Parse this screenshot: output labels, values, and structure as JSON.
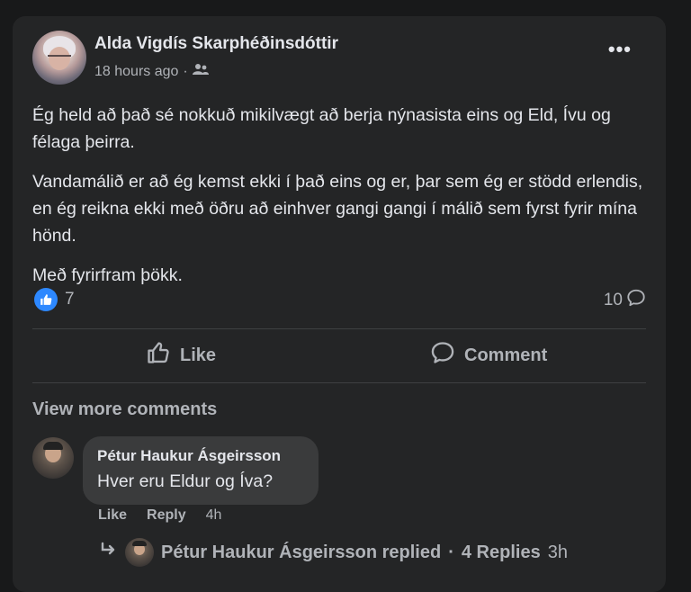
{
  "post": {
    "author": "Alda Vigdís Skarphéðinsdóttir",
    "timestamp": "18 hours ago",
    "separator": "·",
    "audience_icon": "friends-icon",
    "more_icon": "•••",
    "paragraphs": [
      "Ég held að það sé nokkuð mikilvægt að berja nýnasista eins og Eld, Ívu og félaga þeirra.",
      "Vandamálið er að ég kemst ekki í það eins og er, þar sem ég er stödd erlendis, en ég reikna ekki með öðru að einhver gangi gangi í málið sem fyrst fyrir mína hönd.",
      "Með fyrirfram þökk."
    ],
    "reaction_count": "7",
    "comment_count": "10"
  },
  "actions": {
    "like_label": "Like",
    "comment_label": "Comment"
  },
  "comments": {
    "view_more": "View more comments",
    "items": [
      {
        "author": "Pétur Haukur Ásgeirsson",
        "text": "Hver eru Eldur og Íva?",
        "like_label": "Like",
        "reply_label": "Reply",
        "time": "4h",
        "replies_author": "Pétur Haukur Ásgeirsson replied",
        "replies_separator": "·",
        "replies_count": "4 Replies",
        "replies_time": "3h"
      }
    ]
  },
  "colors": {
    "background": "#18191a",
    "card": "#242526",
    "bubble": "#3a3b3c",
    "like_blue": "#2d88ff",
    "primary_text": "#e4e6eb",
    "secondary_text": "#b0b3b8"
  }
}
